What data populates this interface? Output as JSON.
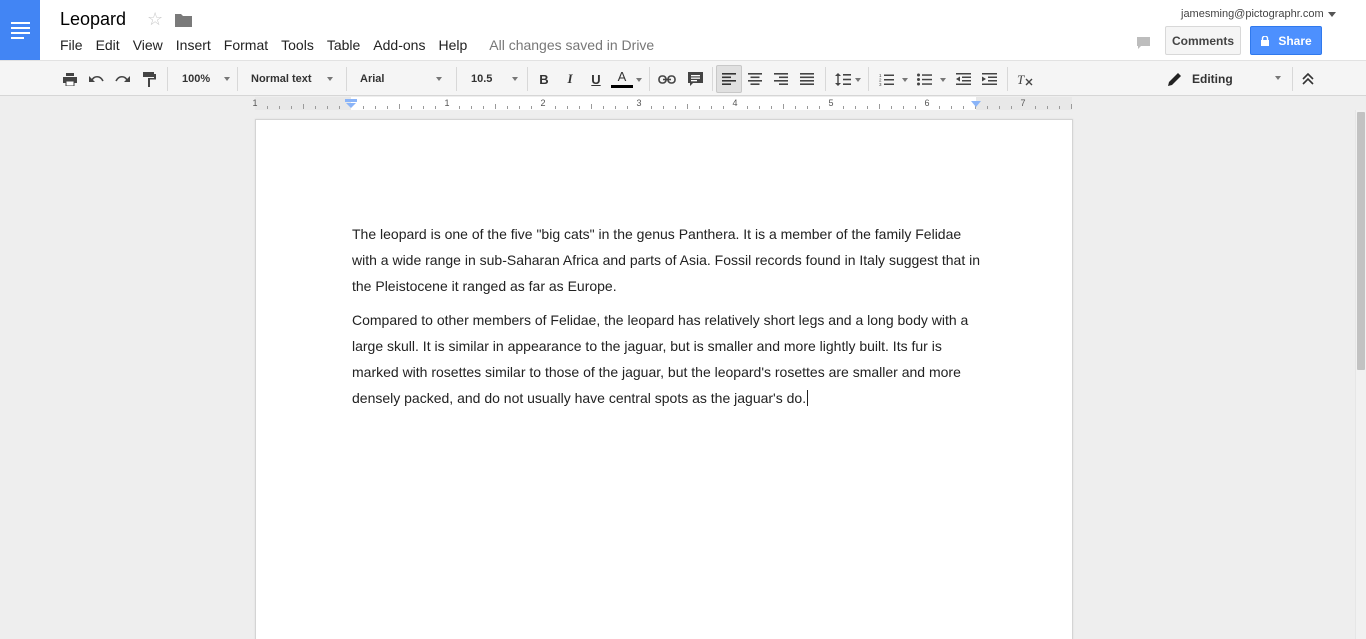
{
  "document": {
    "title": "Leopard",
    "save_status": "All changes saved in Drive",
    "paragraphs": [
      "The leopard is one of the five \"big cats\" in the genus Panthera. It is a member of the family Felidae with a wide range in sub-Saharan Africa and parts of Asia. Fossil records found in Italy suggest that in the Pleistocene it ranged as far as Europe.",
      "Compared to other members of Felidae, the leopard has relatively short legs and a long body with a large skull. It is similar in appearance to the jaguar, but is smaller and more lightly built. Its fur is marked with rosettes similar to those of the jaguar, but the leopard's rosettes are smaller and more densely packed, and do not usually have central spots as the jaguar's do."
    ]
  },
  "menu": {
    "items": [
      "File",
      "Edit",
      "View",
      "Insert",
      "Format",
      "Tools",
      "Table",
      "Add-ons",
      "Help"
    ]
  },
  "account": {
    "email": "jamesming@pictographr.com"
  },
  "buttons": {
    "comments": "Comments",
    "share": "Share"
  },
  "toolbar": {
    "zoom": "100%",
    "style": "Normal text",
    "font": "Arial",
    "font_size": "10.5",
    "bold": "B",
    "italic": "I",
    "underline": "U",
    "text_color_letter": "A",
    "text_color": "#000000",
    "mode": "Editing"
  },
  "ruler": {
    "labels": [
      "1",
      "1",
      "2",
      "3",
      "4",
      "5",
      "6",
      "7"
    ]
  },
  "colors": {
    "brand": "#4285f4",
    "share_button": "#4d90fe",
    "toolbar_bg": "#f5f5f5",
    "canvas_bg": "#eeeeee"
  },
  "icons": [
    "docs-logo-icon",
    "star-icon",
    "folder-icon",
    "print-icon",
    "undo-icon",
    "redo-icon",
    "paint-format-icon",
    "link-icon",
    "comment-add-icon",
    "align-left-icon",
    "align-center-icon",
    "align-right-icon",
    "align-justify-icon",
    "line-spacing-icon",
    "numbered-list-icon",
    "bulleted-list-icon",
    "decrease-indent-icon",
    "increase-indent-icon",
    "clear-formatting-icon",
    "pencil-icon",
    "collapse-icon",
    "chat-icon",
    "lock-icon"
  ]
}
